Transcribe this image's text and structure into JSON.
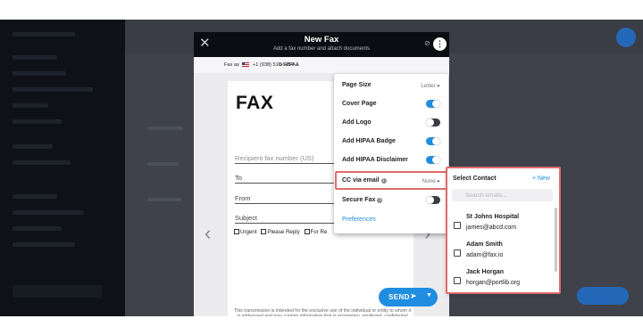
{
  "background": {
    "colors": {
      "sidebar": "#0e1117",
      "overlay": "#4a4d57",
      "accent": "#2469b8"
    }
  },
  "modal": {
    "title": "New Fax",
    "subtitle": "Add a fax number and attach documents",
    "close_icon": "close-icon",
    "kebab_glyph": "⋮",
    "fax_as_label": "Fax as",
    "fax_as_number": "+1 (938) 510-9254",
    "hipaa_label": "HIPAA",
    "document": {
      "heading": "FAX",
      "recipient_placeholder": "Recipient fax number (US)",
      "to_label": "To",
      "from_label": "From",
      "subject_label": "Subject",
      "checkboxes": [
        "Urgent",
        "Please Reply",
        "For Re"
      ],
      "disclaimer": "This transmission is intended for the exclusive use of the individual or entity to whom it is addressed and may contain information that is proprietary, privileged, confidential and/or exempt from disclosure under applicable law."
    },
    "send_label": "SEND",
    "colors": {
      "header": "#0b0d12",
      "primary": "#1f8de0"
    }
  },
  "menu": {
    "page_size": {
      "label": "Page Size",
      "value": "Letter"
    },
    "cover_page": {
      "label": "Cover Page",
      "on": true
    },
    "add_logo": {
      "label": "Add Logo",
      "on": false
    },
    "add_hipaa_badge": {
      "label": "Add HIPAA Badge",
      "on": true
    },
    "add_hipaa_disclaimer": {
      "label": "Add HIPAA Disclaimer",
      "on": true
    },
    "cc_via_email": {
      "label": "CC via email",
      "value": "None"
    },
    "secure_fax": {
      "label": "Secure Fax",
      "on": false
    },
    "preferences": {
      "label": "Preferences"
    },
    "highlight_color": "#df6b6b"
  },
  "contacts": {
    "title": "Select Contact",
    "new_label": "+ New",
    "search_placeholder": "Search emails...",
    "items": [
      {
        "name": "St Johns Hospital",
        "email": "james@abcd.com"
      },
      {
        "name": "Adam Smith",
        "email": "adam@fax.io"
      },
      {
        "name": "Jack Horgan",
        "email": "horgan@portlib.org"
      }
    ]
  }
}
